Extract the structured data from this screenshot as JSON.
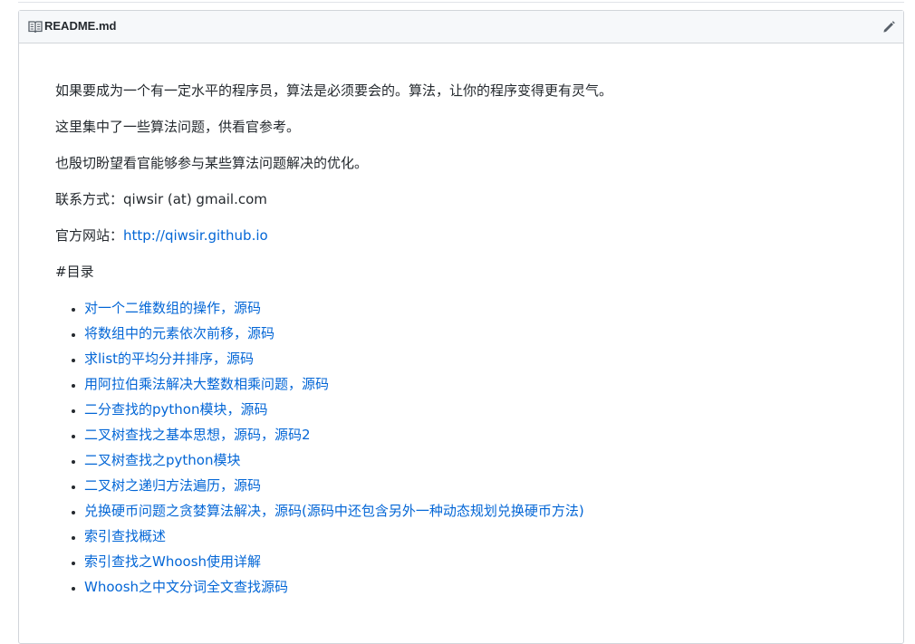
{
  "readme": {
    "filename": "README.md",
    "icons": {
      "file": "book-icon",
      "edit": "pencil-icon"
    },
    "intro": [
      "如果要成为一个有一定水平的程序员，算法是必须要会的。算法，让你的程序变得更有灵气。",
      "这里集中了一些算法问题，供看官参考。",
      "也殷切盼望看官能够参与某些算法问题解决的优化。"
    ],
    "contact_label": "联系方式：",
    "contact_value": "qiwsir (at) gmail.com",
    "site_label": "官方网站：",
    "site_url": "http://qiwsir.github.io",
    "toc_heading": "#目录",
    "toc": [
      "对一个二维数组的操作，源码",
      "将数组中的元素依次前移，源码",
      "求list的平均分并排序，源码",
      "用阿拉伯乘法解决大整数相乘问题，源码",
      "二分查找的python模块，源码",
      "二叉树查找之基本思想，源码，源码2",
      "二叉树查找之python模块",
      "二叉树之递归方法遍历，源码",
      "兑换硬币问题之贪婪算法解决，源码(源码中还包含另外一种动态规划兑换硬币方法)",
      "索引查找概述",
      "索引查找之Whoosh使用详解",
      "Whoosh之中文分词全文查找源码"
    ]
  }
}
